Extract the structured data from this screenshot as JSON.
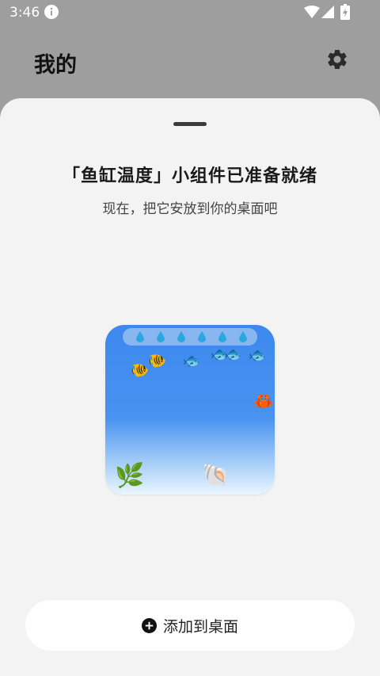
{
  "status_bar": {
    "time": "3:46",
    "icons": [
      "info-icon",
      "wifi-icon",
      "signal-icon",
      "battery-charging-icon"
    ]
  },
  "header": {
    "title": "我的",
    "settings_icon": "gear-icon"
  },
  "sheet": {
    "title": "「鱼缸温度」小组件已准备就绪",
    "subtitle": "现在，把它安放到你的桌面吧",
    "add_button_label": "添加到桌面",
    "add_button_icon": "plus-circle-icon"
  },
  "widget": {
    "drop_count": 6,
    "colors": {
      "water_top": "#3d88ee",
      "water_bottom": "#eaf5ff",
      "bar": "#88b6f0",
      "drop": "#2aa7df"
    },
    "emojis": {
      "clownfish": "🐠",
      "fish": "🐟",
      "crab": "🦀",
      "plant": "🌿",
      "shell": "🐚"
    }
  },
  "colors": {
    "scrim": "#9e9e9e",
    "sheet_bg": "#f3f3f3",
    "button_bg": "#ffffff"
  }
}
